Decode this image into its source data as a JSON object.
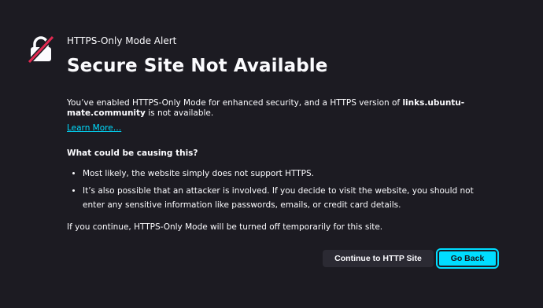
{
  "alert": {
    "label": "HTTPS-Only Mode Alert",
    "title": "Secure Site Not Available",
    "description_prefix": "You’ve enabled HTTPS-Only Mode for enhanced security, and a HTTPS version of ",
    "site": "links.ubuntu-mate.community",
    "description_suffix": " is not available.",
    "learn_more": "Learn More…",
    "causes_heading": "What could be causing this?",
    "causes": [
      "Most likely, the website simply does not support HTTPS.",
      "It’s also possible that an attacker is involved. If you decide to visit the website, you should not enter any sensitive information like passwords, emails, or credit card details."
    ],
    "continue_note": "If you continue, HTTPS-Only Mode will be turned off temporarily for this site."
  },
  "buttons": {
    "continue_label": "Continue to HTTP Site",
    "back_label": "Go Back"
  },
  "icons": {
    "lock": "lock-slashed-icon"
  },
  "colors": {
    "background": "#1c1b22",
    "accent": "#00ddff",
    "slash": "#e22850",
    "secondary_button": "#2b2a33"
  }
}
